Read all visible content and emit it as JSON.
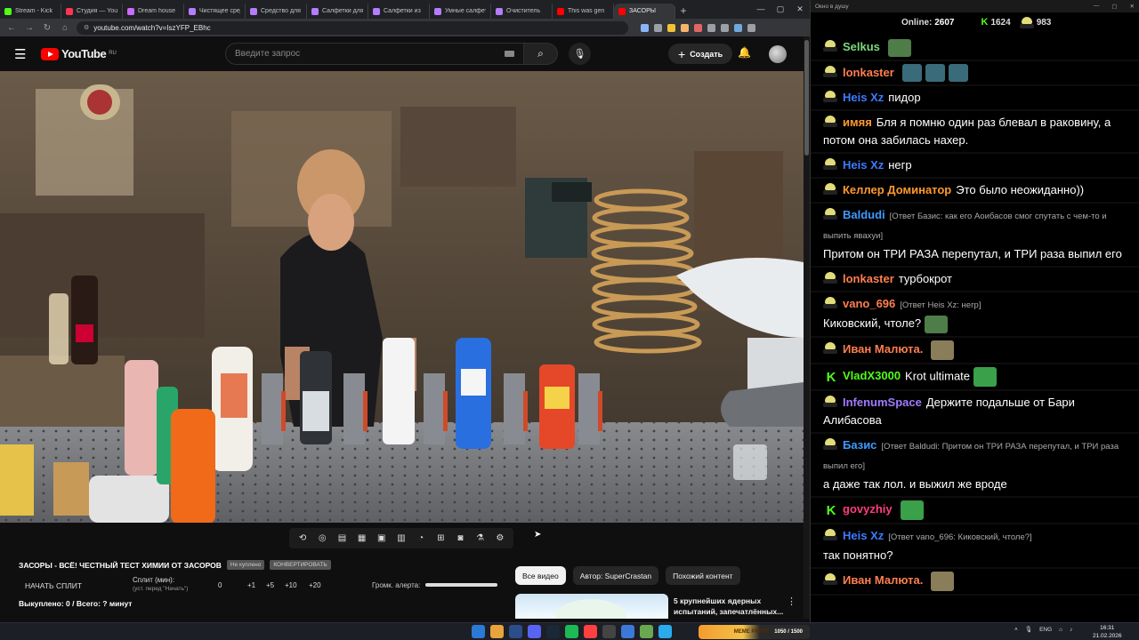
{
  "browser": {
    "tabs": [
      {
        "label": "Stream - Kick",
        "color": "#53fc18",
        "active": false
      },
      {
        "label": "Студия — YouTube",
        "color": "#ff3355",
        "active": false
      },
      {
        "label": "Dream house",
        "color": "#c96cff",
        "active": false
      },
      {
        "label": "Чистящее средство",
        "color": "#b47cff",
        "active": false
      },
      {
        "label": "Средство для",
        "color": "#b47cff",
        "active": false
      },
      {
        "label": "Салфетки для",
        "color": "#b47cff",
        "active": false
      },
      {
        "label": "Салфетки из",
        "color": "#b47cff",
        "active": false
      },
      {
        "label": "Умные салфетки",
        "color": "#b47cff",
        "active": false
      },
      {
        "label": "Очиститель",
        "color": "#b47cff",
        "active": false
      },
      {
        "label": "This was gen",
        "color": "#ff0000",
        "active": false
      },
      {
        "label": "ЗАСОРЫ",
        "color": "#ff0000",
        "active": true
      }
    ],
    "url": "youtube.com/watch?v=IszYFP_EBhc"
  },
  "youtube": {
    "logo": "YouTube",
    "region": "RU",
    "search_placeholder": "Введите запрос",
    "create_label": "Создать",
    "video_title": "ЗАСОРЫ - ВСЁ! ЧЕСТНЫЙ ТЕСТ ХИМИИ ОТ ЗАСОРОВ",
    "title_pill_1": "Не куплено",
    "title_pill_2": "КОНВЕРТИРОВАТЬ",
    "start_split": "НАЧАТЬ СПЛИТ",
    "split_label": "Сплит (мин):",
    "split_sub": "(уст. перед \"Начать\")",
    "split_values": [
      "0",
      "+1",
      "+5",
      "+10",
      "+20"
    ],
    "alert_label": "Громк. алерта:",
    "alert_volume": 1.0,
    "bought": "Выкуплено: 0 / Всего: ? минут",
    "chips": [
      "Все видео",
      "Автор: SuperCrastan",
      "Похожий контент"
    ],
    "rec_title": "5 крупнейших ядерных испытаний, запечатлённых..."
  },
  "chat": {
    "window_title": "Окно в душу",
    "online_label": "Online:",
    "online_count": "2607",
    "stat1": "1624",
    "stat2": "983",
    "messages": [
      {
        "user": "Selkus",
        "color": "#7dd87d",
        "text": "",
        "reply": "",
        "badge": "bot"
      },
      {
        "user": "lonkaster",
        "color": "#ff7f50",
        "text": "",
        "reply": "",
        "badge": "bot"
      },
      {
        "user": "Heis Xz",
        "color": "#3d7bff",
        "text": "пидор",
        "reply": "",
        "badge": "bot"
      },
      {
        "user": "имяя",
        "color": "#ff9a2e",
        "text": "Бля я помню один раз блевал в раковину, а потом она забилась нахер.",
        "reply": "",
        "badge": "bot"
      },
      {
        "user": "Heis Xz",
        "color": "#3d7bff",
        "text": "негр",
        "reply": "",
        "badge": "bot"
      },
      {
        "user": "Келлер Доминатор",
        "color": "#ff9a2e",
        "text": "Это было неожиданно))",
        "reply": "",
        "badge": "bot"
      },
      {
        "user": "Baldudi",
        "color": "#3d9bff",
        "text": "Притом он ТРИ РАЗА перепутал, и ТРИ раза выпил его",
        "reply": "[Ответ Базис: как его Аоибасов смог спутать с чем-то и выпить явахуи]",
        "badge": "bot"
      },
      {
        "user": "lonkaster",
        "color": "#ff7f50",
        "text": "турбокрот",
        "reply": "",
        "badge": "bot"
      },
      {
        "user": "vano_696",
        "color": "#ff7f50",
        "text": "Киковский, чтоле?",
        "reply": "[Ответ Heis Xz: негр]",
        "badge": "bot"
      },
      {
        "user": "Иван Малюта.",
        "color": "#ff7f50",
        "text": "",
        "reply": "",
        "badge": "bot"
      },
      {
        "user": "VladX3000",
        "color": "#53fc18",
        "text": "Krot ultimate",
        "reply": "",
        "badge": "k"
      },
      {
        "user": "InfenumSpace",
        "color": "#a07bff",
        "text": "Держите подальше от Бари Алибасова",
        "reply": "",
        "badge": "bot"
      },
      {
        "user": "Базис",
        "color": "#3d9bff",
        "text": "а даже так лол. и выжил же вроде",
        "reply": "[Ответ Baldudi: Притом он ТРИ РАЗА перепутал, и ТРИ раза выпил его]",
        "badge": "bot"
      },
      {
        "user": "govyzhiy",
        "color": "#ff3d7a",
        "text": "",
        "reply": "",
        "badge": "k"
      },
      {
        "user": "Heis Xz",
        "color": "#3d7bff",
        "text": "так понятно?",
        "reply": "[Ответ vano_696: Киковский, чтоле?]",
        "badge": "bot"
      },
      {
        "user": "Иван Малюта.",
        "color": "#ff7f50",
        "text": "",
        "reply": "",
        "badge": "bot"
      }
    ]
  },
  "taskbar": {
    "game_label": "MEME PARTY",
    "game_progress": "1050 / 1500",
    "lang": "ENG",
    "time": "16:31",
    "date": "21.02.2026"
  }
}
